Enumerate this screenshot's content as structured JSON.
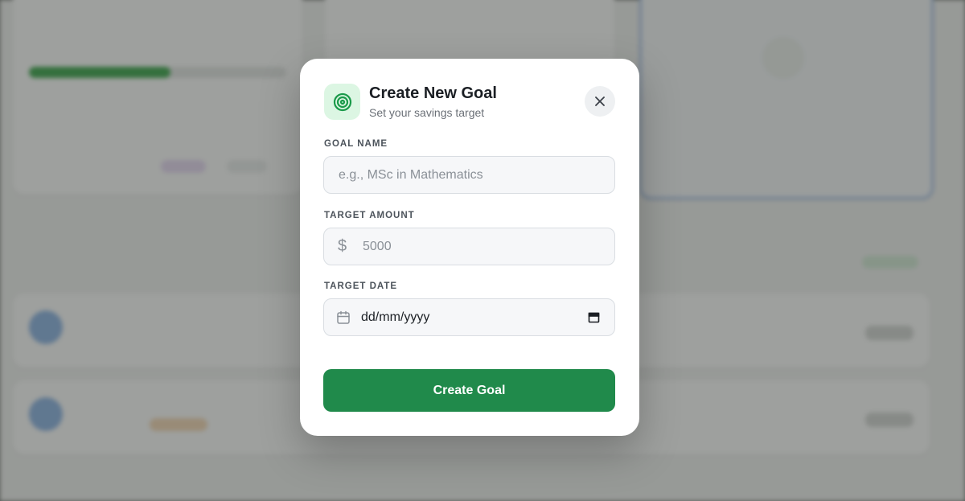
{
  "modal": {
    "title": "Create New Goal",
    "subtitle": "Set your savings target",
    "icon": "target-icon",
    "close_icon": "close-icon",
    "fields": {
      "goal_name": {
        "label": "GOAL NAME",
        "placeholder": "e.g., MSc in Mathematics",
        "value": ""
      },
      "target_amount": {
        "label": "TARGET AMOUNT",
        "prefix": "$",
        "placeholder": "5000",
        "value": ""
      },
      "target_date": {
        "label": "TARGET DATE",
        "value": "dd/mm/yyyy",
        "icon": "calendar-icon",
        "picker_icon": "calendar-picker-icon"
      }
    },
    "submit_label": "Create Goal"
  },
  "colors": {
    "accent": "#208a4b",
    "icon_bg": "#dcf6e3",
    "overlay": "#2c2e2c"
  }
}
